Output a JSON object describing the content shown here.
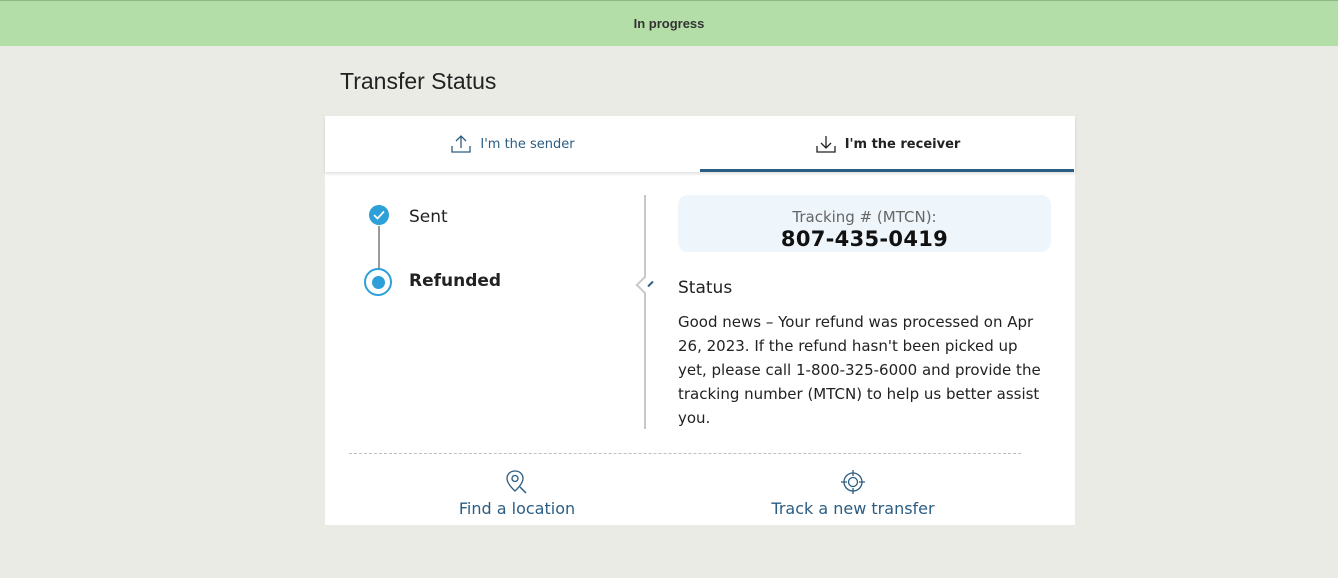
{
  "banner": {
    "text": "In progress"
  },
  "page": {
    "title": "Transfer Status"
  },
  "tabs": {
    "sender": {
      "label": "I'm the sender",
      "icon": "upload-icon"
    },
    "receiver": {
      "label": "I'm the receiver",
      "icon": "download-icon",
      "active": true
    }
  },
  "timeline": {
    "steps": [
      {
        "label": "Sent",
        "state": "completed"
      },
      {
        "label": "Refunded",
        "state": "current"
      }
    ]
  },
  "tracking": {
    "label": "Tracking # (MTCN):",
    "number": "807-435-0419"
  },
  "status": {
    "heading": "Status",
    "message": "Good news – Your refund was processed on Apr 26, 2023. If the refund hasn't been picked up yet, please call 1-800-325-6000 and provide the tracking number (MTCN) to help us better assist you."
  },
  "actions": {
    "find_location": {
      "label": "Find a location",
      "icon": "location-search-icon"
    },
    "track_transfer": {
      "label": "Track a new transfer",
      "icon": "crosshair-icon"
    }
  },
  "colors": {
    "banner_bg": "#b3dea8",
    "page_bg": "#ebebe6",
    "accent_blue": "#2b5d83",
    "step_blue": "#2d9fd9",
    "tracking_bg": "#eef5fb"
  }
}
